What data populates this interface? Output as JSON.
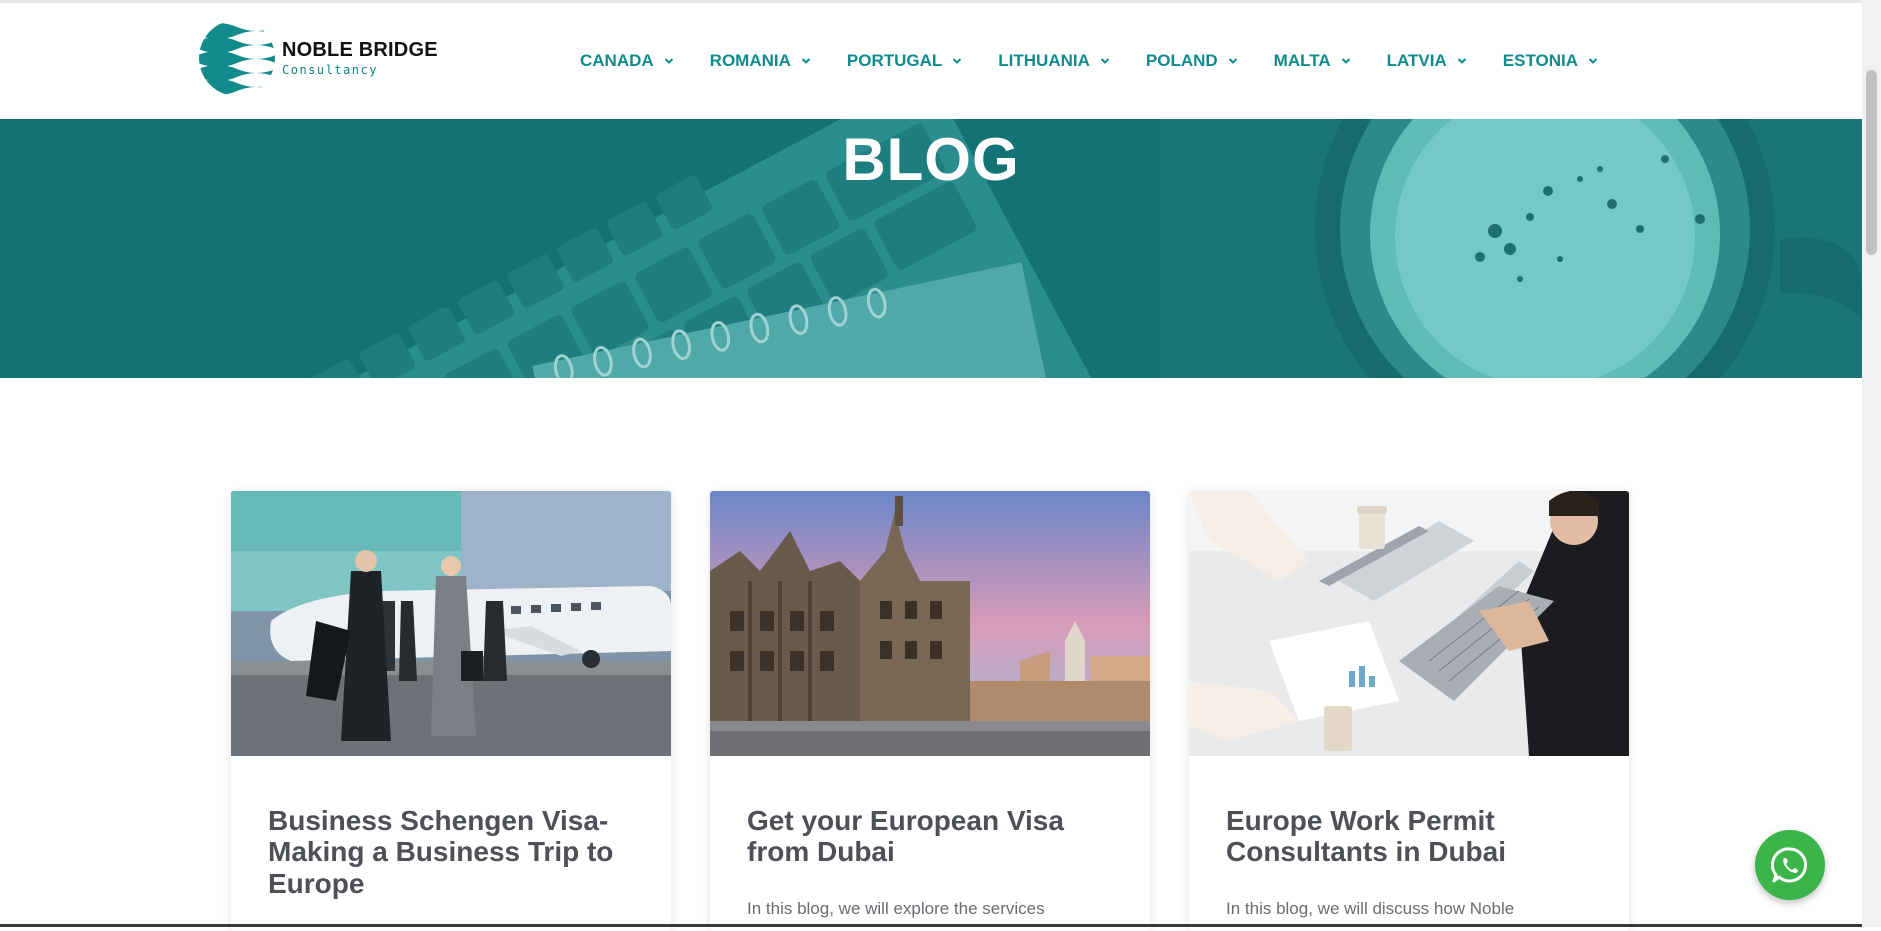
{
  "brand": {
    "name": "NOBLE BRIDGE",
    "sub": "Consultancy",
    "color": "#138a8c"
  },
  "nav": [
    {
      "label": "CANADA"
    },
    {
      "label": "ROMANIA"
    },
    {
      "label": "PORTUGAL"
    },
    {
      "label": "LITHUANIA"
    },
    {
      "label": "POLAND"
    },
    {
      "label": "MALTA"
    },
    {
      "label": "LATVIA"
    },
    {
      "label": "ESTONIA"
    }
  ],
  "hero": {
    "title": "BLOG"
  },
  "posts": [
    {
      "title": "Business Schengen Visa- Making a Business Trip to Europe",
      "excerpt": ""
    },
    {
      "title": "Get your European Visa from Dubai",
      "excerpt": "In this blog, we will explore the services"
    },
    {
      "title": "Europe Work Permit Consultants in Dubai",
      "excerpt": "In this blog, we will discuss how Noble"
    }
  ],
  "whatsapp": {
    "icon": "whatsapp-icon",
    "color": "#3bb44a"
  }
}
